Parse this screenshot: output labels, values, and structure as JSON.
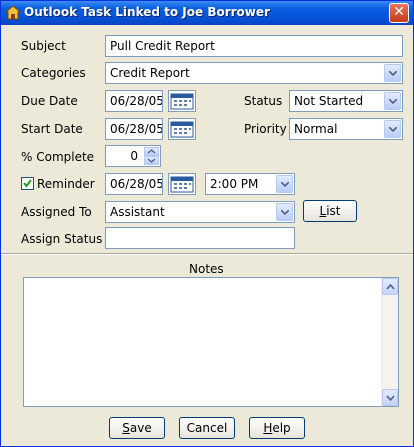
{
  "window": {
    "title": "Outlook Task Linked to Joe Borrower"
  },
  "form": {
    "subject_label": "Subject",
    "subject_value": "Pull Credit Report",
    "categories_label": "Categories",
    "categories_value": "Credit Report",
    "due_date_label": "Due Date",
    "due_date_value": "06/28/05",
    "status_label": "Status",
    "status_value": "Not Started",
    "start_date_label": "Start Date",
    "start_date_value": "06/28/05",
    "priority_label": "Priority",
    "priority_value": "Normal",
    "percent_label": "% Complete",
    "percent_value": "0",
    "reminder_label": "Reminder",
    "reminder_checked": true,
    "reminder_date_value": "06/28/05",
    "reminder_time_value": "2:00 PM",
    "assigned_to_label": "Assigned To",
    "assigned_to_value": "Assistant",
    "list_button": {
      "underline": "L",
      "rest": "ist"
    },
    "assign_status_label": "Assign Status",
    "assign_status_value": ""
  },
  "notes": {
    "label": "Notes",
    "value": ""
  },
  "buttons": {
    "save": {
      "underline": "S",
      "rest": "ave"
    },
    "cancel": {
      "label": "Cancel"
    },
    "help": {
      "underline": "H",
      "rest": "elp"
    }
  },
  "icons": {
    "title": "house-icon",
    "close": "close-icon",
    "calendar": "calendar-icon",
    "dropdown": "chevron-down-icon"
  },
  "colors": {
    "titlebar": "#0a5fe0",
    "window_bg": "#ece9d8",
    "field_border": "#7f9db9"
  }
}
